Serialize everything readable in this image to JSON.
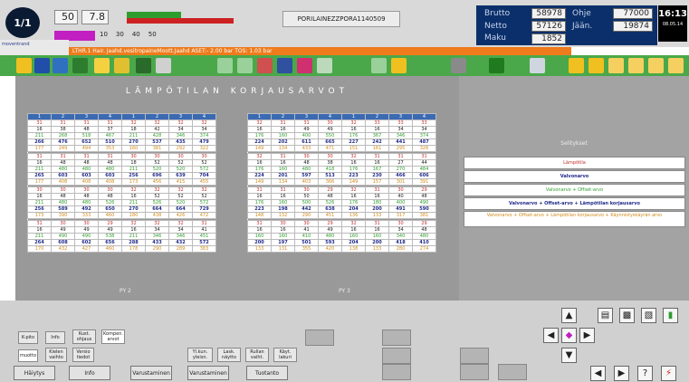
{
  "header": {
    "page_indicator": "1/1",
    "speed_value": "50",
    "speed_decimal": "7.8",
    "scale_marks": [
      "10",
      "30",
      "40",
      "50"
    ],
    "train_id": "PORILAINEZZPORA1140509",
    "stats": [
      {
        "label": "Brutto",
        "value": "58978",
        "label2": "Ohje",
        "value2": "77000"
      },
      {
        "label": "Netto",
        "value": "57126",
        "label2": "Jään.",
        "value2": "19874"
      },
      {
        "label": "Maku",
        "value": "1852"
      }
    ],
    "clock_time": "16:13",
    "clock_date": "08.05.14"
  },
  "status_strip": "LTHR.1 Hair. Jaahd.vesitropaineMoott.Jaahd ASET:- 2.00 bar TOS: 1.03 bar",
  "logo_text": "moventrand",
  "main": {
    "title": "LÄMPÖTILAN KORJAUSARVOT",
    "col_headers": [
      "1",
      "2",
      "3",
      "4",
      "1",
      "2",
      "3",
      "4"
    ],
    "py2_label": "PY 2",
    "py3_label": "PY 3",
    "table_left": [
      [
        "31",
        "31",
        "31",
        "31",
        "32",
        "32",
        "32",
        "32"
      ],
      [
        "16",
        "38",
        "48",
        "37",
        "18",
        "42",
        "34",
        "34"
      ],
      [
        "211",
        "268",
        "518",
        "467",
        "211",
        "428",
        "346",
        "374"
      ],
      [
        "266",
        "476",
        "652",
        "510",
        "270",
        "537",
        "435",
        "479"
      ],
      [
        "177",
        "249",
        "494",
        "353",
        "160",
        "381",
        "292",
        "322"
      ],
      [
        "31",
        "31",
        "31",
        "31",
        "30",
        "30",
        "30",
        "30"
      ],
      [
        "16",
        "48",
        "48",
        "48",
        "18",
        "52",
        "52",
        "52"
      ],
      [
        "211",
        "480",
        "480",
        "480",
        "211",
        "520",
        "520",
        "572"
      ],
      [
        "265",
        "603",
        "603",
        "603",
        "256",
        "696",
        "639",
        "704"
      ],
      [
        "177",
        "408",
        "408",
        "408",
        "173",
        "456",
        "415",
        "455"
      ],
      [
        "30",
        "30",
        "30",
        "30",
        "32",
        "32",
        "32",
        "32"
      ],
      [
        "16",
        "48",
        "48",
        "48",
        "16",
        "52",
        "52",
        "52"
      ],
      [
        "211",
        "480",
        "480",
        "526",
        "211",
        "526",
        "520",
        "572"
      ],
      [
        "256",
        "589",
        "492",
        "650",
        "270",
        "664",
        "664",
        "729"
      ],
      [
        "173",
        "390",
        "333",
        "460",
        "180",
        "438",
        "426",
        "472"
      ],
      [
        "31",
        "30",
        "30",
        "29",
        "32",
        "32",
        "32",
        "31"
      ],
      [
        "16",
        "49",
        "49",
        "49",
        "16",
        "34",
        "34",
        "41"
      ],
      [
        "211",
        "490",
        "490",
        "538",
        "211",
        "346",
        "346",
        "451"
      ],
      [
        "264",
        "608",
        "602",
        "656",
        "288",
        "433",
        "432",
        "572"
      ],
      [
        "170",
        "432",
        "427",
        "460",
        "178",
        "290",
        "289",
        "383"
      ]
    ],
    "table_right": [
      [
        "32",
        "31",
        "31",
        "30",
        "32",
        "33",
        "33",
        "33"
      ],
      [
        "16",
        "16",
        "49",
        "49",
        "16",
        "16",
        "34",
        "34"
      ],
      [
        "176",
        "160",
        "400",
        "550",
        "176",
        "367",
        "346",
        "374"
      ],
      [
        "224",
        "202",
        "611",
        "665",
        "227",
        "242",
        "441",
        "487"
      ],
      [
        "149",
        "134",
        "433",
        "471",
        "151",
        "161",
        "295",
        "326"
      ],
      [
        "32",
        "31",
        "30",
        "30",
        "32",
        "31",
        "31",
        "31"
      ],
      [
        "16",
        "16",
        "48",
        "38",
        "16",
        "16",
        "27",
        "44"
      ],
      [
        "176",
        "160",
        "480",
        "418",
        "176",
        "167",
        "270",
        "484"
      ],
      [
        "224",
        "201",
        "597",
        "513",
        "223",
        "230",
        "466",
        "606"
      ],
      [
        "149",
        "134",
        "403",
        "366",
        "149",
        "157",
        "301",
        "391"
      ],
      [
        "31",
        "31",
        "30",
        "29",
        "32",
        "31",
        "30",
        "29"
      ],
      [
        "16",
        "16",
        "50",
        "48",
        "16",
        "16",
        "40",
        "48"
      ],
      [
        "176",
        "160",
        "500",
        "526",
        "176",
        "180",
        "400",
        "490"
      ],
      [
        "223",
        "198",
        "442",
        "638",
        "204",
        "200",
        "491",
        "590"
      ],
      [
        "148",
        "132",
        "290",
        "451",
        "136",
        "133",
        "317",
        "381"
      ],
      [
        "31",
        "30",
        "30",
        "29",
        "32",
        "31",
        "30",
        "29"
      ],
      [
        "16",
        "16",
        "41",
        "49",
        "16",
        "16",
        "34",
        "48"
      ],
      [
        "160",
        "160",
        "410",
        "480",
        "160",
        "160",
        "340",
        "480"
      ],
      [
        "200",
        "197",
        "501",
        "593",
        "204",
        "200",
        "418",
        "410"
      ],
      [
        "133",
        "131",
        "355",
        "420",
        "138",
        "133",
        "280",
        "274"
      ]
    ]
  },
  "legend": {
    "title": "Selitykset",
    "rows": [
      "Lämpötila",
      "Valvonarvo",
      "Valvonarvo + Offset-arvo",
      "Valvonarvo + Offset-arvo + Lämpötilan korjausarvo",
      "Valvonarvo + Offset-arvo + Lämpötilan korjausarvo + Käynnistyskäyrän arvo"
    ]
  },
  "bottom": {
    "row1": [
      "K-pito",
      "Info",
      "Kust. ohjaus",
      "Kompen. arvot"
    ],
    "row2": [
      "muotto",
      "Kielen vaihto",
      "Versio tiedot",
      "Yl.kun. yleisn.",
      "Lask. näytto",
      "Rullan vaiht.",
      "Käyt. lakuri"
    ],
    "nav": [
      "Häiytys",
      "Info",
      "Varustaminen",
      "Varustaminen",
      "Tuotanto"
    ]
  },
  "colors": {
    "header_bg": "#d9d9d9",
    "toolbar_green": "#4aa84a",
    "status_orange": "#ef7b1c",
    "stats_navy": "#0b2f6a",
    "table_header_blue": "#3b6ab3",
    "main_grey": "#999999"
  }
}
